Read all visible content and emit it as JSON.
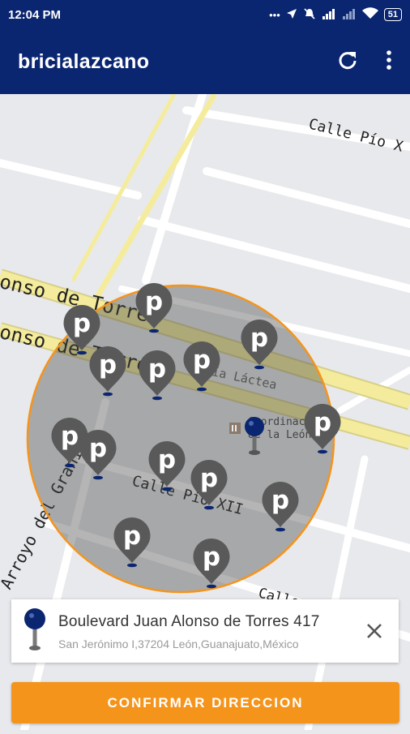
{
  "status_bar": {
    "time": "12:04 PM",
    "battery": "51",
    "icons": [
      "more-dots-icon",
      "location-arrow-icon",
      "mute-icon",
      "signal-icon",
      "signal-icon",
      "wifi-icon",
      "battery-icon"
    ]
  },
  "app_bar": {
    "title": "bricialazcano",
    "actions": [
      "refresh-icon",
      "overflow-menu-icon"
    ]
  },
  "map": {
    "street_labels": [
      "Calle Pío X",
      "Alonso de Torres",
      "Alonso de Torres",
      "Calle Pío XII",
      "Arroyo del Granizo",
      "Calle",
      "Calle"
    ],
    "poi_labels": [
      "Vía Láctea",
      "Coordinación",
      "de la León M"
    ],
    "radius_color": "#f5941b",
    "parking_marker_count": 16
  },
  "address_card": {
    "main": "Boulevard Juan Alonso de Torres 417",
    "sub": "San Jerónimo I,37204 León,Guanajuato,México"
  },
  "confirm_button": {
    "label": "CONFIRMAR DIRECCION"
  },
  "colors": {
    "primary": "#0b2670",
    "accent": "#f5941b",
    "map_bg": "#e8e9ec",
    "marker_gray": "#595959"
  }
}
